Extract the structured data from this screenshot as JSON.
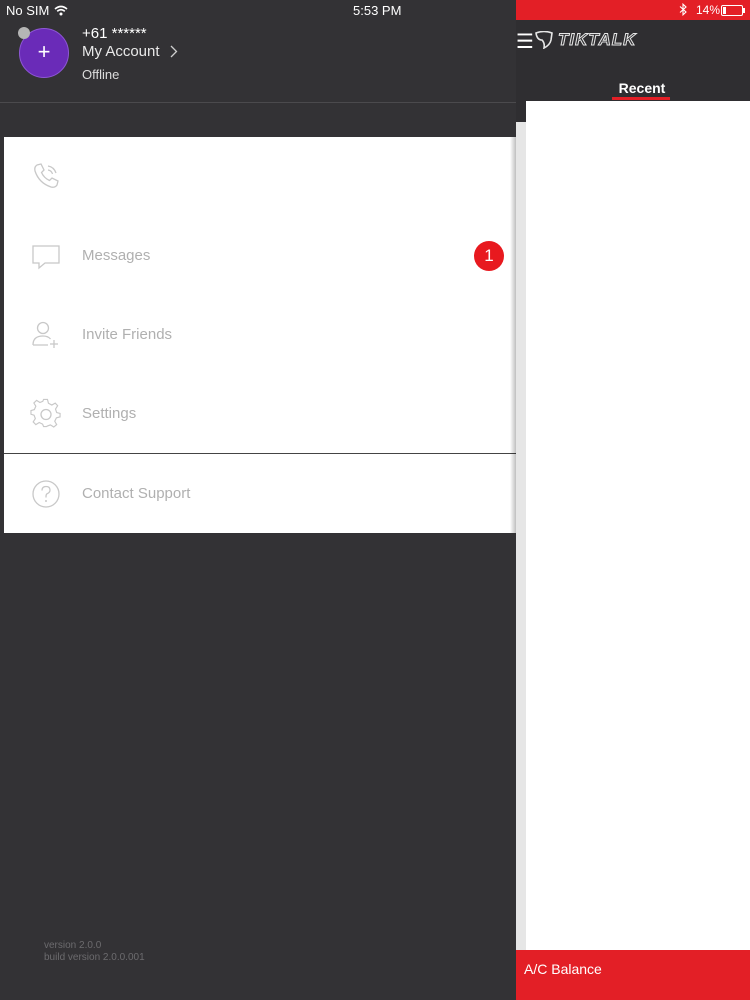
{
  "status_bar": {
    "carrier": "No SIM",
    "time": "5:53 PM",
    "battery_percent": "14%",
    "battery_level": 0.14
  },
  "account": {
    "avatar_glyph": "+",
    "phone": "+61 ******",
    "my_account_label": "My Account",
    "presence": "Offline"
  },
  "menu": {
    "items": [
      {
        "label": "",
        "icon": "phone-icon"
      },
      {
        "label": "Messages",
        "icon": "message-icon",
        "badge": "1"
      },
      {
        "label": "Invite Friends",
        "icon": "add-user-icon"
      },
      {
        "label": "Settings",
        "icon": "gear-icon"
      },
      {
        "label": "Contact Support",
        "icon": "question-icon"
      }
    ]
  },
  "versions": {
    "version": "version 2.0.0",
    "build": "build version 2.0.0.001"
  },
  "app": {
    "menu_glyph": "☰",
    "logo_text": "TIKTALK",
    "tab_recent": "Recent",
    "balance_label": "A/C Balance"
  },
  "colors": {
    "accent_red": "#e31f26",
    "avatar_purple": "#6a2bb8",
    "drawer_bg": "#333235"
  }
}
